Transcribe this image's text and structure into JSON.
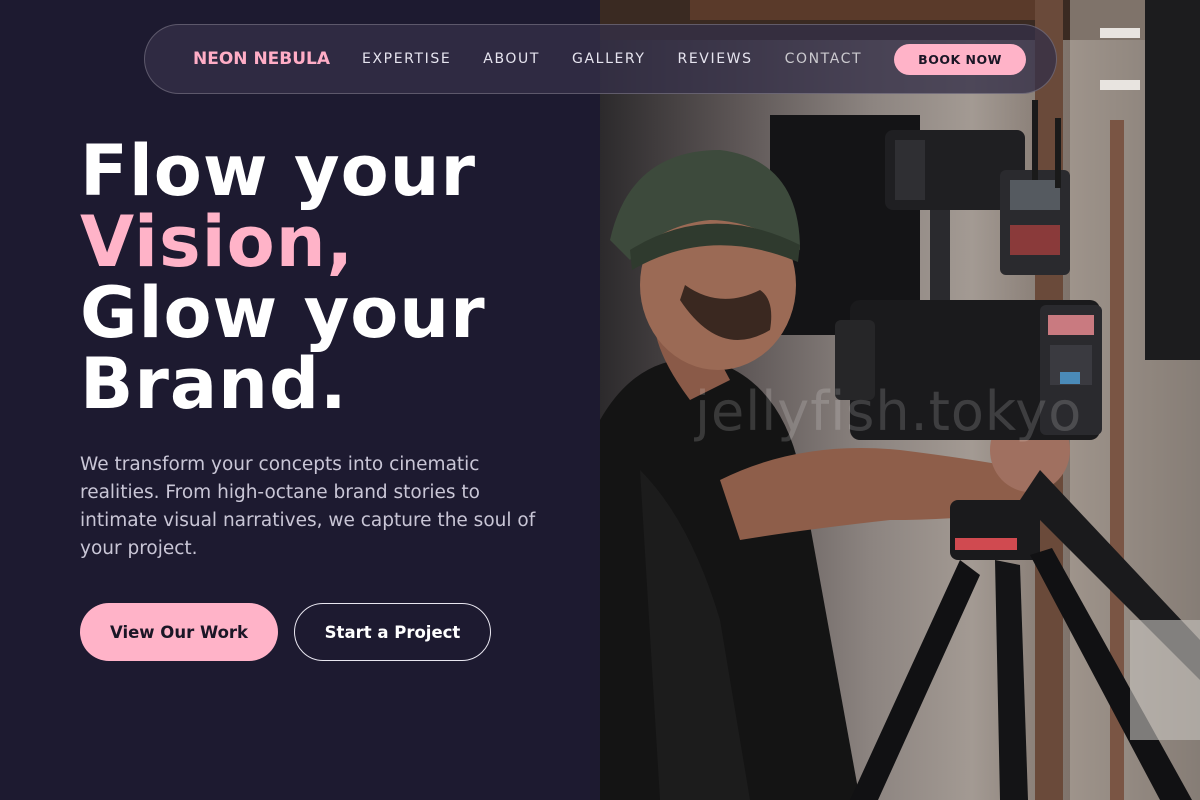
{
  "nav": {
    "brand": "NEON NEBULA",
    "links": [
      "EXPERTISE",
      "ABOUT",
      "GALLERY",
      "REVIEWS",
      "CONTACT"
    ],
    "book_label": "BOOK NOW"
  },
  "hero": {
    "line1": "Flow your",
    "line2": "Vision,",
    "line3": "Glow your",
    "line4": "Brand.",
    "description": "We transform your concepts into cinematic realities. From high-octane brand stories to intimate visual narratives, we capture the soul of your project.",
    "primary_cta": "View Our Work",
    "secondary_cta": "Start a Project"
  },
  "photo": {
    "watermark": "jellyfish.tokyo",
    "subject": "videographer operating a cinema camera on a tripod"
  },
  "colors": {
    "background": "#1d1a30",
    "accent_pink": "#ffb3c8",
    "text_white": "#ffffff",
    "text_muted": "#c9c6d6"
  }
}
